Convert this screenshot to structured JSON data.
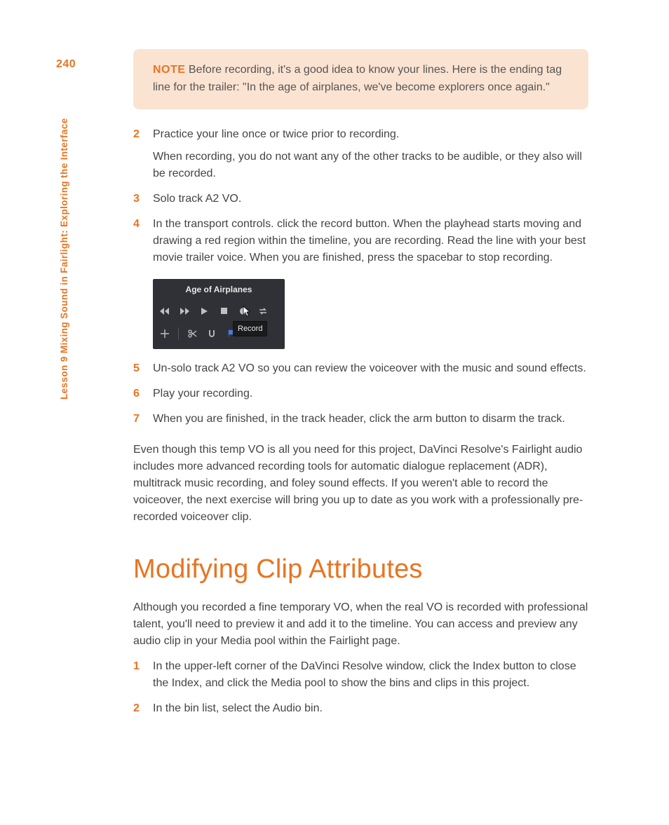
{
  "page_number": "240",
  "side_title": "Lesson 9   Mixing Sound in Fairlight: Exploring the Interface",
  "note": {
    "label": "NOTE",
    "text": "  Before recording, it's a good idea to know your lines. Here is the ending tag line for the trailer: \"In the age of airplanes, we've become explorers once again.\""
  },
  "steps_a": [
    {
      "num": "2",
      "paras": [
        "Practice your line once or twice prior to recording.",
        "When recording, you do not want any of the other tracks to be audible, or they also will be recorded."
      ]
    },
    {
      "num": "3",
      "paras": [
        "Solo track A2 VO."
      ]
    },
    {
      "num": "4",
      "paras": [
        "In the transport controls. click the record button. When the playhead starts moving and drawing a red region within the timeline, you are recording. Read the line with your best movie trailer voice. When you are finished, press the spacebar to stop recording."
      ]
    }
  ],
  "transport": {
    "title": "Age of Airplanes",
    "tooltip": "Record"
  },
  "steps_b": [
    {
      "num": "5",
      "paras": [
        "Un-solo track A2 VO so you can review the voiceover with the music and sound effects."
      ]
    },
    {
      "num": "6",
      "paras": [
        "Play your recording."
      ]
    },
    {
      "num": "7",
      "paras": [
        "When you are finished, in the track header, click the arm button to disarm the track."
      ]
    }
  ],
  "closing_para": "Even though this temp VO is all you need for this project, DaVinci Resolve's Fairlight audio includes more advanced recording tools for automatic dialogue replacement (ADR), multitrack music recording, and foley sound effects. If you weren't able to record the voiceover, the next exercise will bring you up to date as you work with a professionally pre-recorded voiceover clip.",
  "section_heading": "Modifying Clip Attributes",
  "section_intro": "Although you recorded a fine temporary VO, when the real VO is recorded with professional talent, you'll need to preview it and add it to the timeline. You can access and preview any audio clip in your Media pool within the Fairlight page.",
  "steps_c": [
    {
      "num": "1",
      "paras": [
        "In the upper-left corner of the DaVinci Resolve window, click the Index button to close the Index, and click the Media pool to show the bins and clips in this project."
      ]
    },
    {
      "num": "2",
      "paras": [
        "In the bin list, select the Audio bin."
      ]
    }
  ]
}
